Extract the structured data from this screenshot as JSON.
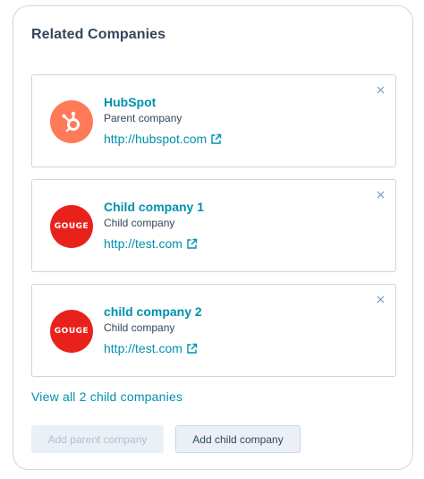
{
  "panel": {
    "title": "Related Companies"
  },
  "companies": [
    {
      "name": "HubSpot",
      "type": "Parent company",
      "url": "http://hubspot.com",
      "logo": "hubspot-sprocket-icon",
      "logo_color": "#ff7a59"
    },
    {
      "name": "Child company 1",
      "type": "Child company",
      "url": "http://test.com",
      "logo": "gouge-logo",
      "logo_text": "GOUGE",
      "logo_color": "#e8221b"
    },
    {
      "name": "child company 2",
      "type": "Child company",
      "url": "http://test.com",
      "logo": "gouge-logo",
      "logo_text": "GOUGE",
      "logo_color": "#e8221b"
    }
  ],
  "view_all_link": "View all 2 child companies",
  "buttons": {
    "add_parent": "Add parent company",
    "add_child": "Add child company"
  },
  "colors": {
    "link": "#0091ae",
    "text": "#33475b",
    "border": "#cbd6e2",
    "button_bg": "#eaf0f6",
    "disabled_text": "#b0c1d4"
  }
}
